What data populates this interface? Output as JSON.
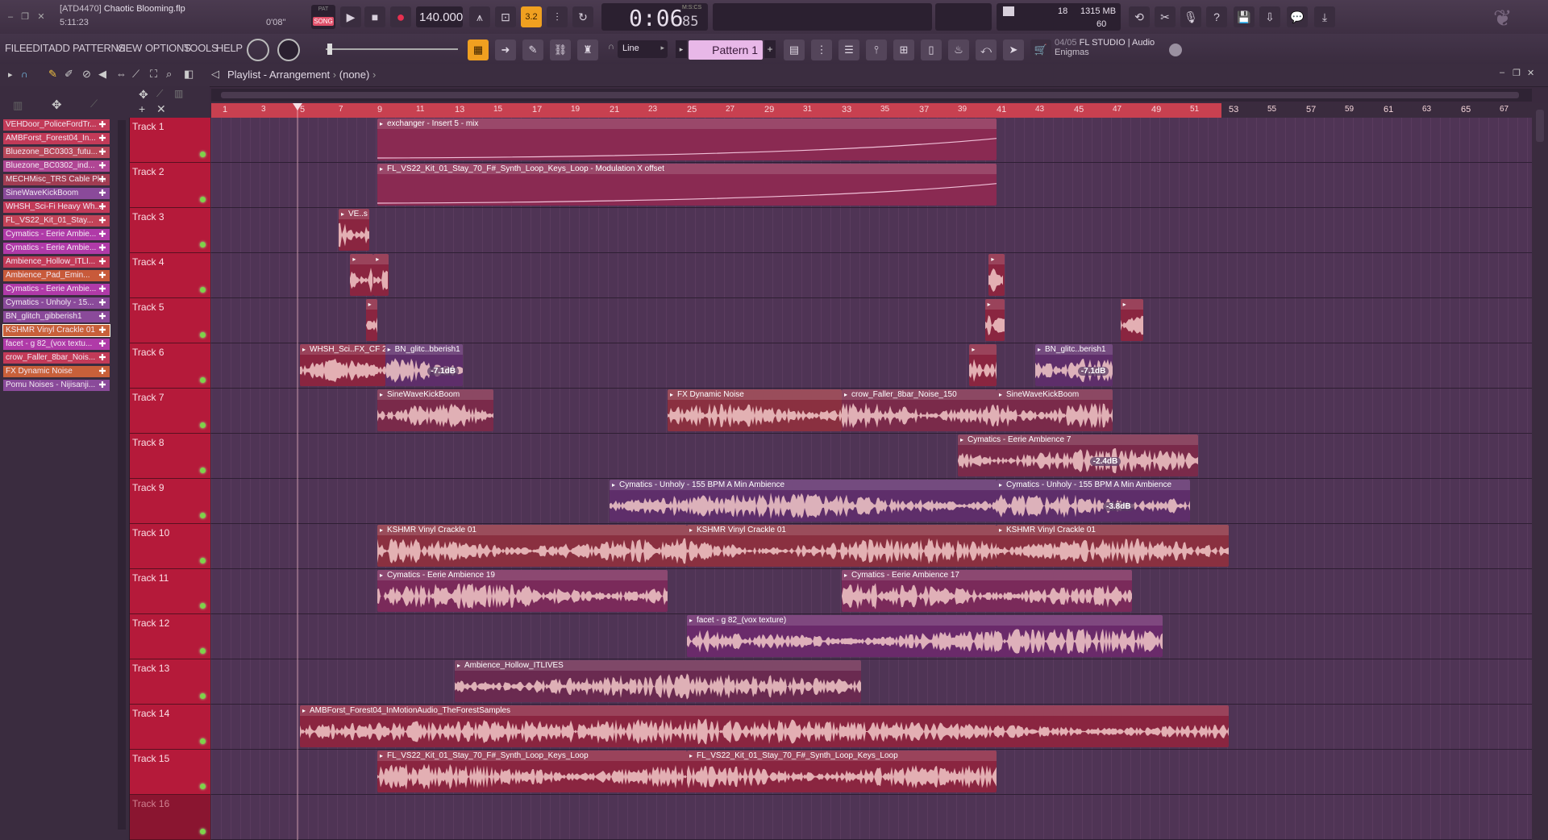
{
  "window": {
    "project_code": "[ATD4470]",
    "project_name": "Chaotic Blooming.flp",
    "song_position": "5:11:23",
    "offset": "0'08\""
  },
  "transport": {
    "mode_pat": "PAT",
    "mode_song": "SONG",
    "tempo": "140.000",
    "time": "0:06",
    "time_sub": "85",
    "time_label": "M:S:CS",
    "cpu": "18",
    "memory": "1315 MB",
    "polyphony": "60"
  },
  "menus": [
    "FILE",
    "EDIT",
    "ADD",
    "PATTERNS",
    "VIEW",
    "OPTIONS",
    "TOOLS",
    "HELP"
  ],
  "toolbar": {
    "snap": "Line",
    "pattern": "Pattern 1",
    "news_date": "04/05",
    "news_line1": "FL STUDIO | Audio",
    "news_line2": "Enigmas"
  },
  "playlist": {
    "title": "Playlist - Arrangement",
    "breadcrumb_sep": "›",
    "clip_source": "(none)"
  },
  "browser_clips": [
    {
      "label": "VEHDoor_PoliceFordTr...",
      "color": "#c23a58"
    },
    {
      "label": "AMBForst_Forest04_In...",
      "color": "#c23a58"
    },
    {
      "label": "Bluezone_BC0303_futu...",
      "color": "#b8485a"
    },
    {
      "label": "Bluezone_BC0302_ind...",
      "color": "#b04694"
    },
    {
      "label": "MECHMisc_TRS Cable Pl...",
      "color": "#a13c52"
    },
    {
      "label": "SineWaveKickBoom",
      "color": "#8a4a9a"
    },
    {
      "label": "WHSH_Sci-Fi Heavy Wh...",
      "color": "#c23a58"
    },
    {
      "label": "FL_VS22_Kit_01_Stay...",
      "color": "#c24358"
    },
    {
      "label": "Cymatics - Eerie Ambie...",
      "color": "#b03aa8"
    },
    {
      "label": "Cymatics - Eerie Ambie...",
      "color": "#b03aa8"
    },
    {
      "label": "Ambience_Hollow_ITLI...",
      "color": "#c23a58"
    },
    {
      "label": "Ambience_Pad_Emin...",
      "color": "#c85a3a"
    },
    {
      "label": "Cymatics - Eerie Ambie...",
      "color": "#b03aa8"
    },
    {
      "label": "Cymatics - Unholy - 15...",
      "color": "#8a4a9a"
    },
    {
      "label": "BN_glitch_gibberish1",
      "color": "#8a4a9a"
    },
    {
      "label": "KSHMR Vinyl Crackle 01",
      "color": "#c8603a"
    },
    {
      "label": "facet - g 82_(vox textu...",
      "color": "#b03aa8"
    },
    {
      "label": "crow_Faller_8bar_Nois...",
      "color": "#c23a58"
    },
    {
      "label": "FX Dynamic Noise",
      "color": "#c8603a"
    },
    {
      "label": "Pomu Noises - Nijisanji...",
      "color": "#8a4a9a"
    }
  ],
  "tracks": [
    "Track 1",
    "Track 2",
    "Track 3",
    "Track 4",
    "Track 5",
    "Track 6",
    "Track 7",
    "Track 8",
    "Track 9",
    "Track 10",
    "Track 11",
    "Track 12",
    "Track 13",
    "Track 14",
    "Track 15",
    "Track 16"
  ],
  "ruler_numbers": [
    "1",
    "3",
    "5",
    "7",
    "9",
    "11",
    "13",
    "15",
    "17",
    "19",
    "21",
    "23",
    "25",
    "27",
    "29",
    "31",
    "33",
    "35",
    "37",
    "39",
    "41",
    "43",
    "45",
    "47",
    "49",
    "51",
    "53",
    "55",
    "57",
    "59",
    "61",
    "63",
    "65",
    "67"
  ],
  "clips": [
    {
      "track": 0,
      "start": 9,
      "end": 41,
      "label": "exchanger - Insert 5 - mix",
      "color": "#8a2a52",
      "auto": true
    },
    {
      "track": 1,
      "start": 9,
      "end": 41,
      "label": "FL_VS22_Kit_01_Stay_70_F#_Synth_Loop_Keys_Loop - Modulation X offset",
      "color": "#8a2a52",
      "auto": true
    },
    {
      "track": 2,
      "start": 7,
      "end": 8.6,
      "label": "VE..s",
      "color": "#8a2540"
    },
    {
      "track": 3,
      "start": 7.6,
      "end": 8.8,
      "label": "",
      "color": "#8a2540"
    },
    {
      "track": 3,
      "start": 8.8,
      "end": 9.6,
      "label": "",
      "color": "#8a2540"
    },
    {
      "track": 3,
      "start": 40.6,
      "end": 41.4,
      "label": "",
      "color": "#8a2540"
    },
    {
      "track": 4,
      "start": 8.4,
      "end": 9,
      "label": "",
      "color": "#8a2540"
    },
    {
      "track": 4,
      "start": 40.4,
      "end": 41.4,
      "label": "",
      "color": "#8a2540"
    },
    {
      "track": 4,
      "start": 47.4,
      "end": 48.6,
      "label": "",
      "color": "#8a2540"
    },
    {
      "track": 5,
      "start": 5,
      "end": 9.4,
      "label": "WHSH_Sci..FX_CF 29",
      "color": "#8a2540"
    },
    {
      "track": 5,
      "start": 9.4,
      "end": 13.4,
      "label": "BN_glitc..bberish1",
      "color": "#5e2e6a",
      "gain": "-7.1dB"
    },
    {
      "track": 5,
      "start": 39.6,
      "end": 41,
      "label": "",
      "color": "#8a2540"
    },
    {
      "track": 5,
      "start": 43,
      "end": 47,
      "label": "BN_glitc..berish1",
      "color": "#5e2e6a",
      "gain": "-7.1dB"
    },
    {
      "track": 6,
      "start": 9,
      "end": 15,
      "label": "SineWaveKickBoom",
      "color": "#7a2a4a"
    },
    {
      "track": 6,
      "start": 24,
      "end": 33,
      "label": "FX Dynamic Noise",
      "color": "#8a3040"
    },
    {
      "track": 6,
      "start": 33,
      "end": 41,
      "label": "crow_Faller_8bar_Noise_150",
      "color": "#7a2a4a"
    },
    {
      "track": 6,
      "start": 41,
      "end": 47,
      "label": "SineWaveKickBoom",
      "color": "#7a2a4a"
    },
    {
      "track": 7,
      "start": 39,
      "end": 51.4,
      "label": "Cymatics - Eerie Ambience 7",
      "color": "#7a2a4a",
      "gain": "-2.4dB"
    },
    {
      "track": 8,
      "start": 21,
      "end": 41,
      "label": "Cymatics - Unholy - 155 BPM A Min Ambience",
      "color": "#5e2e6a"
    },
    {
      "track": 8,
      "start": 41,
      "end": 51,
      "label": "Cymatics - Unholy - 155 BPM A Min Ambience",
      "color": "#5e2e6a",
      "gain": "-3.8dB"
    },
    {
      "track": 9,
      "start": 9,
      "end": 25,
      "label": "KSHMR Vinyl Crackle 01",
      "color": "#8a3040"
    },
    {
      "track": 9,
      "start": 25,
      "end": 41,
      "label": "KSHMR Vinyl Crackle 01",
      "color": "#8a3040"
    },
    {
      "track": 9,
      "start": 41,
      "end": 53,
      "label": "KSHMR Vinyl Crackle 01",
      "color": "#8a3040"
    },
    {
      "track": 10,
      "start": 9,
      "end": 24,
      "label": "Cymatics - Eerie Ambience 19",
      "color": "#7a2a5a"
    },
    {
      "track": 10,
      "start": 33,
      "end": 48,
      "label": "Cymatics - Eerie Ambience 17",
      "color": "#7a2a5a"
    },
    {
      "track": 11,
      "start": 25,
      "end": 49.6,
      "label": "facet - g 82_(vox texture)",
      "color": "#6a2a6a"
    },
    {
      "track": 12,
      "start": 13,
      "end": 34,
      "label": "Ambience_Hollow_ITLIVES",
      "color": "#6a2a50"
    },
    {
      "track": 13,
      "start": 5,
      "end": 53,
      "label": "AMBForst_Forest04_InMotionAudio_TheForestSamples",
      "color": "#8a2540"
    },
    {
      "track": 14,
      "start": 9,
      "end": 25,
      "label": "FL_VS22_Kit_01_Stay_70_F#_Synth_Loop_Keys_Loop",
      "color": "#8a2540"
    },
    {
      "track": 14,
      "start": 25,
      "end": 41,
      "label": "FL_VS22_Kit_01_Stay_70_F#_Synth_Loop_Keys_Loop",
      "color": "#8a2540"
    }
  ]
}
